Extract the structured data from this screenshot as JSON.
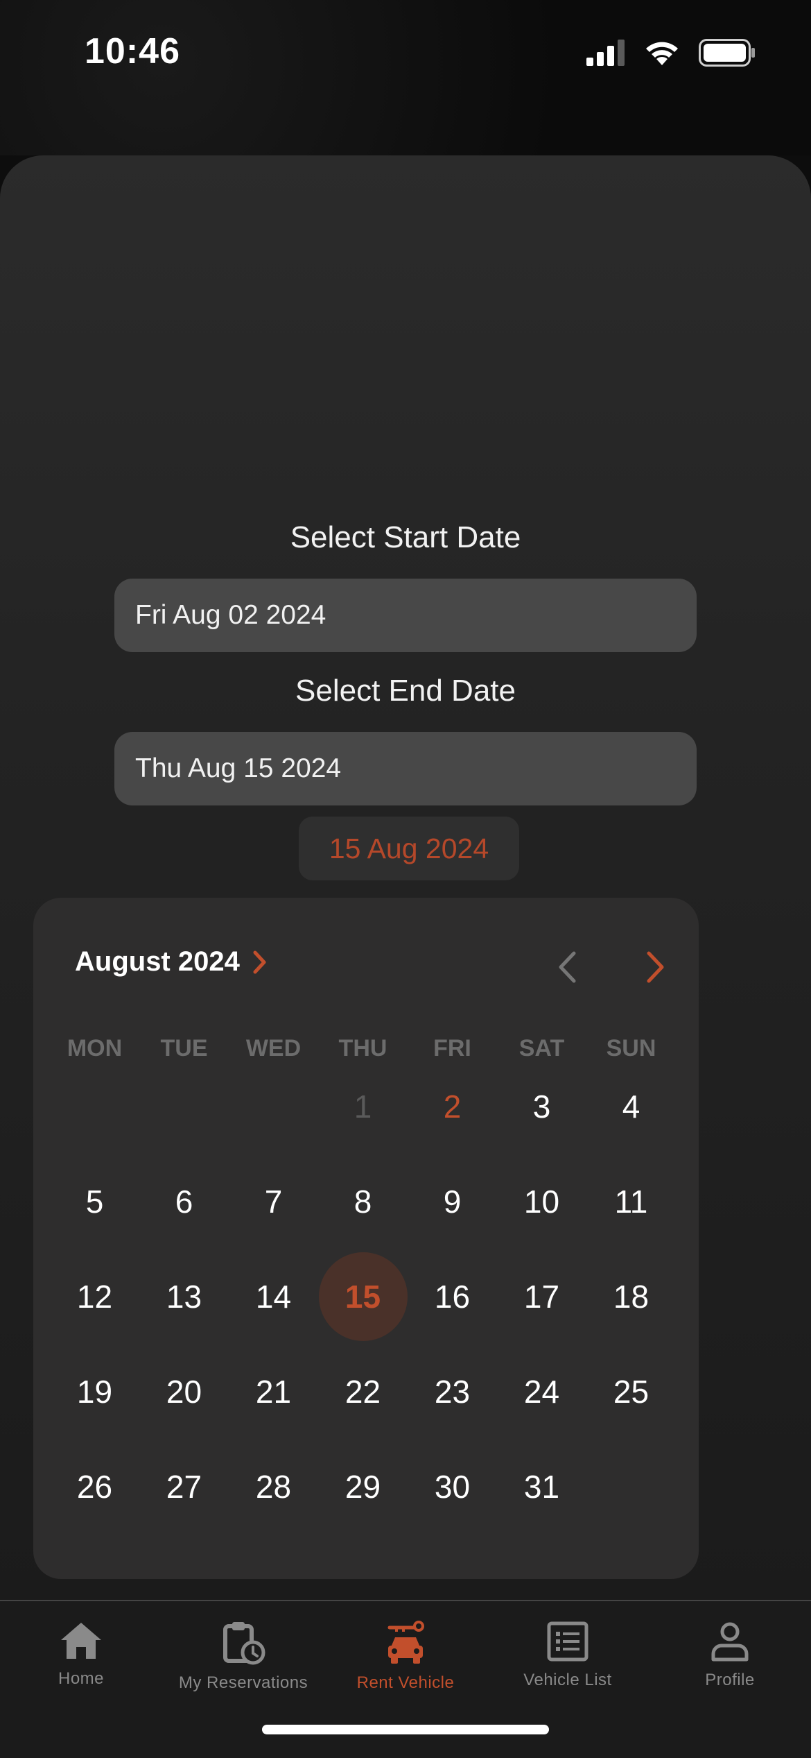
{
  "status_bar": {
    "time": "10:46"
  },
  "form": {
    "start_label": "Select Start Date",
    "start_value": "Fri Aug 02 2024",
    "end_label": "Select End Date",
    "end_value": "Thu Aug 15 2024",
    "selected_pill": "15 Aug 2024"
  },
  "calendar": {
    "month_title": "August 2024",
    "weekdays": [
      "MON",
      "TUE",
      "WED",
      "THU",
      "FRI",
      "SAT",
      "SUN"
    ],
    "days": [
      "",
      "",
      "",
      "1",
      "2",
      "3",
      "4",
      "5",
      "6",
      "7",
      "8",
      "9",
      "10",
      "11",
      "12",
      "13",
      "14",
      "15",
      "16",
      "17",
      "18",
      "19",
      "20",
      "21",
      "22",
      "23",
      "24",
      "25",
      "26",
      "27",
      "28",
      "29",
      "30",
      "31",
      ""
    ],
    "selected_day": "15",
    "start_day": "2",
    "disabled_day": "1"
  },
  "tabs": [
    {
      "label": "Home",
      "icon": "home-icon"
    },
    {
      "label": "My Reservations",
      "icon": "clipboard-clock-icon"
    },
    {
      "label": "Rent Vehicle",
      "icon": "car-key-icon"
    },
    {
      "label": "Vehicle List",
      "icon": "list-icon"
    },
    {
      "label": "Profile",
      "icon": "person-icon"
    }
  ],
  "colors": {
    "accent": "#c24f2c",
    "background": "#0d0d0d",
    "field": "#484848",
    "calendar_bg": "#2e2d2d"
  }
}
